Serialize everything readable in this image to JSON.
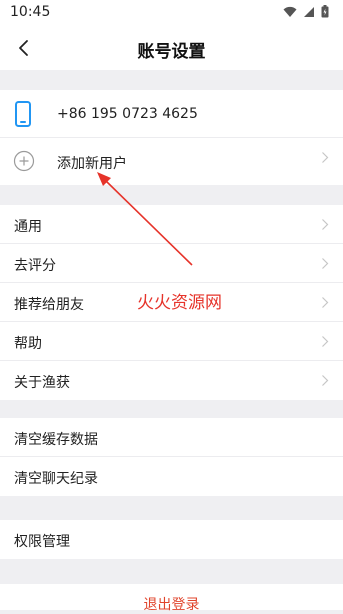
{
  "status": {
    "time": "10:45"
  },
  "header": {
    "title": "账号设置"
  },
  "account": {
    "phone": "+86 195 0723 4625",
    "add_user": "添加新用户"
  },
  "menu": {
    "general": "通用",
    "rate": "去评分",
    "recommend": "推荐给朋友",
    "help": "帮助",
    "about": "关于渔获"
  },
  "storage": {
    "clear_cache": "清空缓存数据",
    "clear_chat": "清空聊天纪录"
  },
  "permissions": {
    "label": "权限管理"
  },
  "logout": {
    "label": "退出登录"
  },
  "watermark": {
    "text": "火火资源网"
  },
  "colors": {
    "accent": "#e0452d",
    "phone_icon": "#2196f3",
    "annotation": "#e6332a"
  },
  "icons": [
    "back-icon",
    "phone-icon",
    "add-circle-icon",
    "chevron-right-icon",
    "wifi-icon",
    "signal-icon",
    "battery-icon"
  ]
}
